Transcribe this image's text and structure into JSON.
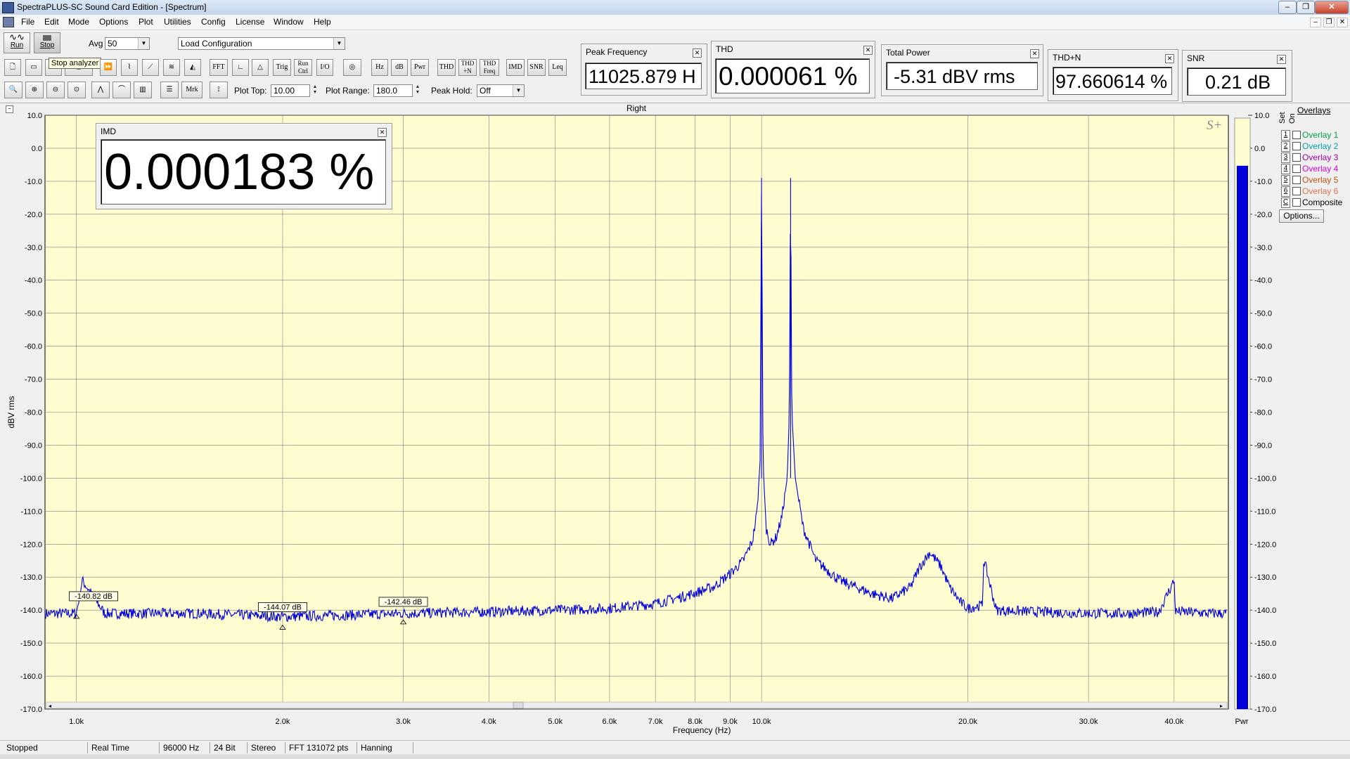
{
  "window": {
    "title": "SpectraPLUS-SC Sound Card Edition - [Spectrum]"
  },
  "menu": [
    "File",
    "Edit",
    "Mode",
    "Options",
    "Plot",
    "Utilities",
    "Config",
    "License",
    "Window",
    "Help"
  ],
  "toolbar": {
    "run_label": "Run",
    "stop_label": "Stop",
    "stop_tooltip": "Stop analyzer",
    "avg_label": "Avg",
    "avg_value": "50",
    "config_value": "Load Configuration",
    "buttons_row2": [
      "FFT",
      "Trig",
      "Run Ctrl",
      "I/O",
      "Hz",
      "dB",
      "Pwr",
      "THD",
      "THD +N",
      "THD Freq",
      "IMD",
      "SNR",
      "Leq"
    ],
    "buttons_row3": [
      "Mrk"
    ],
    "plot_top_label": "Plot Top:",
    "plot_top_value": "10.00",
    "plot_range_label": "Plot Range:",
    "plot_range_value": "180.0",
    "peak_hold_label": "Peak Hold:",
    "peak_hold_value": "Off"
  },
  "meters": {
    "peak_frequency": {
      "title": "Peak Frequency",
      "value": "11025.879 H"
    },
    "thd": {
      "title": "THD",
      "value": "0.000061 %"
    },
    "total_power": {
      "title": "Total Power",
      "value": "-5.31 dBV rms"
    },
    "thd_n": {
      "title": "THD+N",
      "value": "97.660614 %"
    },
    "snr": {
      "title": "SNR",
      "value": "0.21 dB"
    },
    "imd": {
      "title": "IMD",
      "value": "0.000183 %"
    }
  },
  "plot": {
    "channel_label": "Right",
    "logo": "S+",
    "pwr_label": "Pwr",
    "colors": {
      "background": "#fffdd0",
      "trace": "#0000dd",
      "grid": "#808080",
      "bar": "#0000dd"
    },
    "power_bar_level_dbv": -5.31,
    "markers": [
      {
        "label": "-140.82 dB",
        "freq": 1000,
        "db": -140.8
      },
      {
        "label": "-144.07 dB",
        "freq": 2000,
        "db": -144.1
      },
      {
        "label": "-142.46 dB",
        "freq": 3000,
        "db": -142.5
      }
    ]
  },
  "overlays": {
    "title": "Overlays",
    "set_label": "Set",
    "on_label": "On",
    "items": [
      {
        "num": "1",
        "label": "Overlay 1",
        "color": "#00a050"
      },
      {
        "num": "2",
        "label": "Overlay 2",
        "color": "#00a0a0"
      },
      {
        "num": "3",
        "label": "Overlay 3",
        "color": "#a000a0"
      },
      {
        "num": "4",
        "label": "Overlay 4",
        "color": "#e000e0"
      },
      {
        "num": "5",
        "label": "Overlay 5",
        "color": "#c05010"
      },
      {
        "num": "6",
        "label": "Overlay 6",
        "color": "#e07050"
      },
      {
        "num": "C",
        "label": "Composite",
        "color": "#000000"
      }
    ],
    "options_label": "Options..."
  },
  "chart_data": {
    "type": "line",
    "title": "Right",
    "xlabel": "Frequency (Hz)",
    "ylabel": "dBV rms",
    "xscale": "log",
    "xlim": [
      900,
      48000
    ],
    "ylim": [
      -170,
      10
    ],
    "grid": true,
    "x_ticks": [
      1000,
      2000,
      3000,
      4000,
      5000,
      6000,
      7000,
      8000,
      9000,
      10000,
      20000,
      30000,
      40000
    ],
    "x_tick_labels": [
      "1.0k",
      "2.0k",
      "3.0k",
      "4.0k",
      "5.0k",
      "6.0k",
      "7.0k",
      "8.0k",
      "9.0k",
      "10.0k",
      "20.0k",
      "30.0k",
      "40.0k"
    ],
    "y_ticks": [
      10,
      0,
      -10,
      -20,
      -30,
      -40,
      -50,
      -60,
      -70,
      -80,
      -90,
      -100,
      -110,
      -120,
      -130,
      -140,
      -150,
      -160,
      -170
    ],
    "y_tick_labels": [
      "10.0",
      "0.0",
      "-10.0",
      "-20.0",
      "-30.0",
      "-40.0",
      "-50.0",
      "-60.0",
      "-70.0",
      "-80.0",
      "-90.0",
      "-100.0",
      "-110.0",
      "-120.0",
      "-130.0",
      "-140.0",
      "-150.0",
      "-160.0",
      "-170.0"
    ],
    "series": [
      {
        "x": [
          900,
          1000,
          1020,
          1100,
          1500,
          2000,
          2500,
          3000,
          4000,
          5000,
          6000,
          7000,
          7800,
          8500,
          9000,
          9400,
          9700,
          9850,
          9950,
          10000,
          10050,
          10150,
          10300,
          10500,
          10700,
          10900,
          10980,
          11025,
          11070,
          11200,
          11500,
          12000,
          13000,
          14500,
          15500,
          16500,
          17000,
          17600,
          18000,
          18300,
          18800,
          19500,
          20000,
          20400,
          21000,
          21100,
          22000,
          25000,
          30000,
          35000,
          38000,
          40000,
          40200,
          41000,
          45000,
          48000
        ],
        "y": [
          -141,
          -141,
          -131,
          -141,
          -141,
          -142,
          -141.5,
          -141,
          -140.5,
          -140,
          -139.5,
          -138,
          -135.5,
          -133,
          -129,
          -125,
          -119,
          -110,
          -95,
          -9,
          -95,
          -115,
          -120,
          -118,
          -112,
          -100,
          -80,
          -9,
          -80,
          -100,
          -115,
          -125,
          -131,
          -135,
          -136.5,
          -133,
          -127,
          -122.5,
          -125,
          -127,
          -133,
          -137.5,
          -139.5,
          -139,
          -138.5,
          -124.5,
          -140,
          -140.5,
          -141,
          -141,
          -140.5,
          -131,
          -140.5,
          -140.5,
          -141,
          -141
        ]
      }
    ]
  },
  "status": {
    "state": "Stopped",
    "mode": "Real Time",
    "sample_rate": "96000 Hz",
    "bits": "24 Bit",
    "channels": "Stereo",
    "fft": "FFT 131072 pts",
    "window": "Hanning"
  }
}
